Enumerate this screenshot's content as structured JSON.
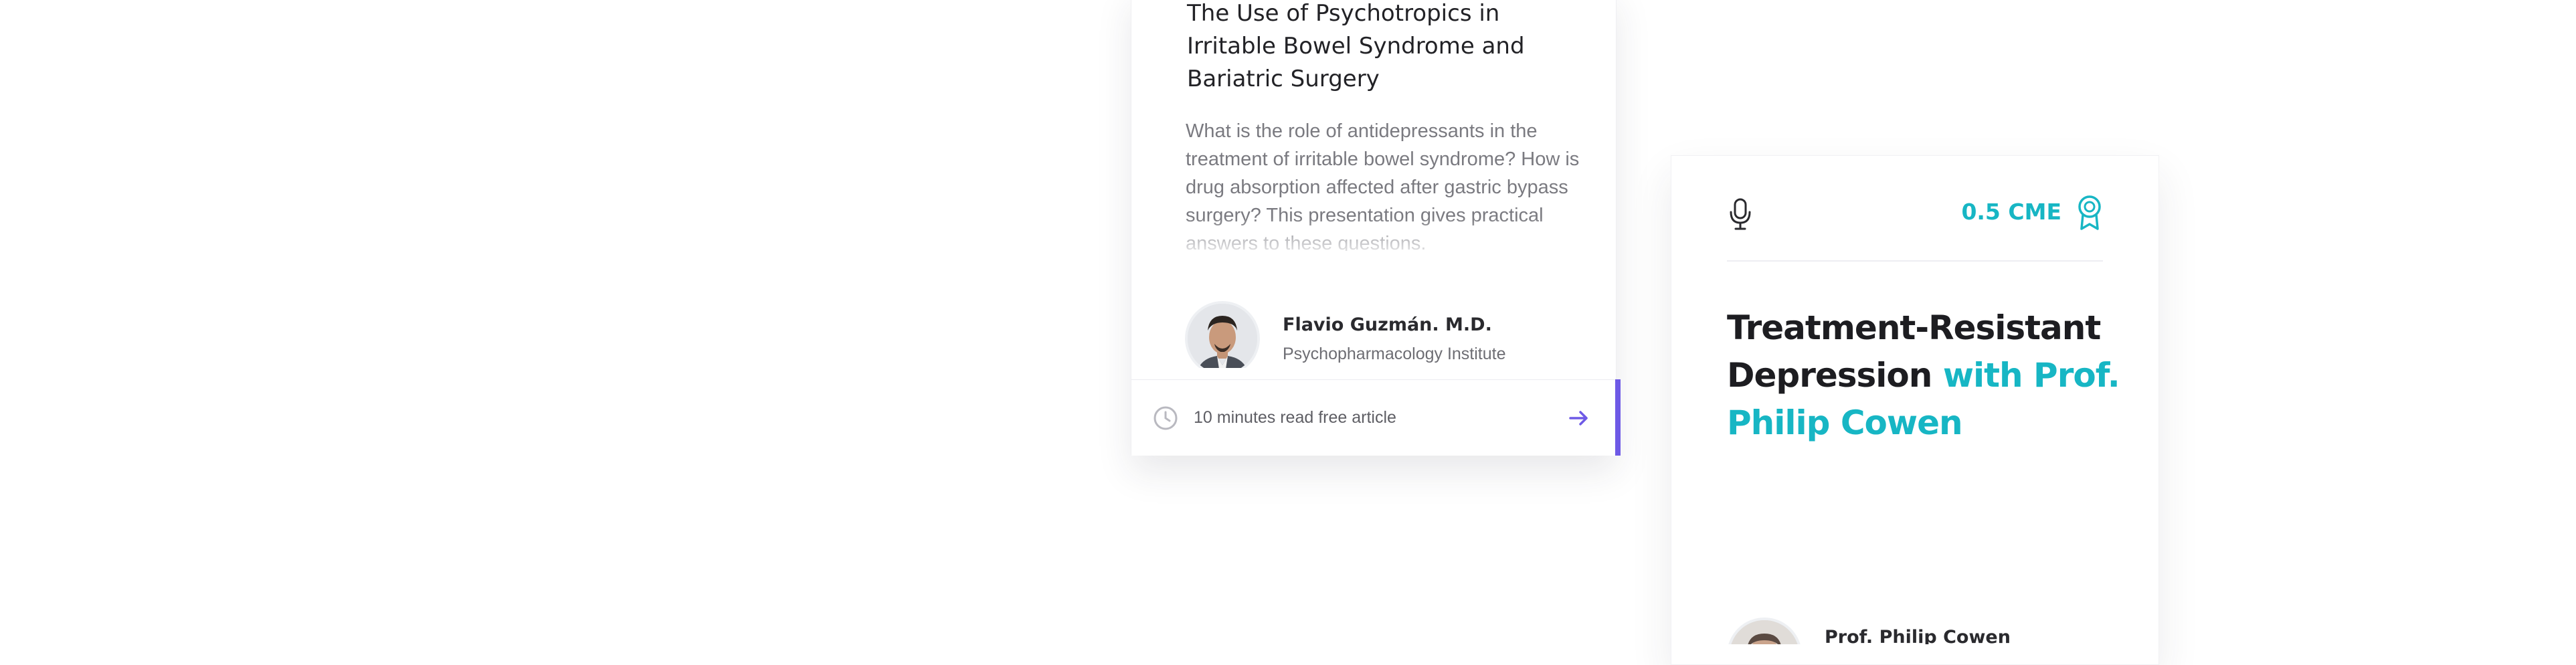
{
  "article_card": {
    "title": "The Use of Psychotropics in Irritable Bowel Syndrome and Bariatric Surgery",
    "excerpt": "What is the role of antidepressants in the treatment of irritable bowel syndrome? How is drug absorption affected after gastric bypass surgery? This presentation gives practical answers to these questions.",
    "author": {
      "name": "Flavio Guzmán. M.D.",
      "institution": "Psychopharmacology Institute"
    },
    "footer": {
      "icon": "clock-icon",
      "text": "10 minutes read free article",
      "action_icon": "arrow-right-icon"
    },
    "accent_color": "#6e5ae6"
  },
  "podcast_card": {
    "type_icon": "microphone-icon",
    "cme_label": "0.5 CME",
    "cme_icon": "award-ribbon-icon",
    "title_main": "Treatment-Resistant Depression",
    "title_accent": "with Prof. Philip Cowen",
    "author": {
      "name": "Prof. Philip Cowen"
    },
    "accent_color": "#17b6c4"
  }
}
